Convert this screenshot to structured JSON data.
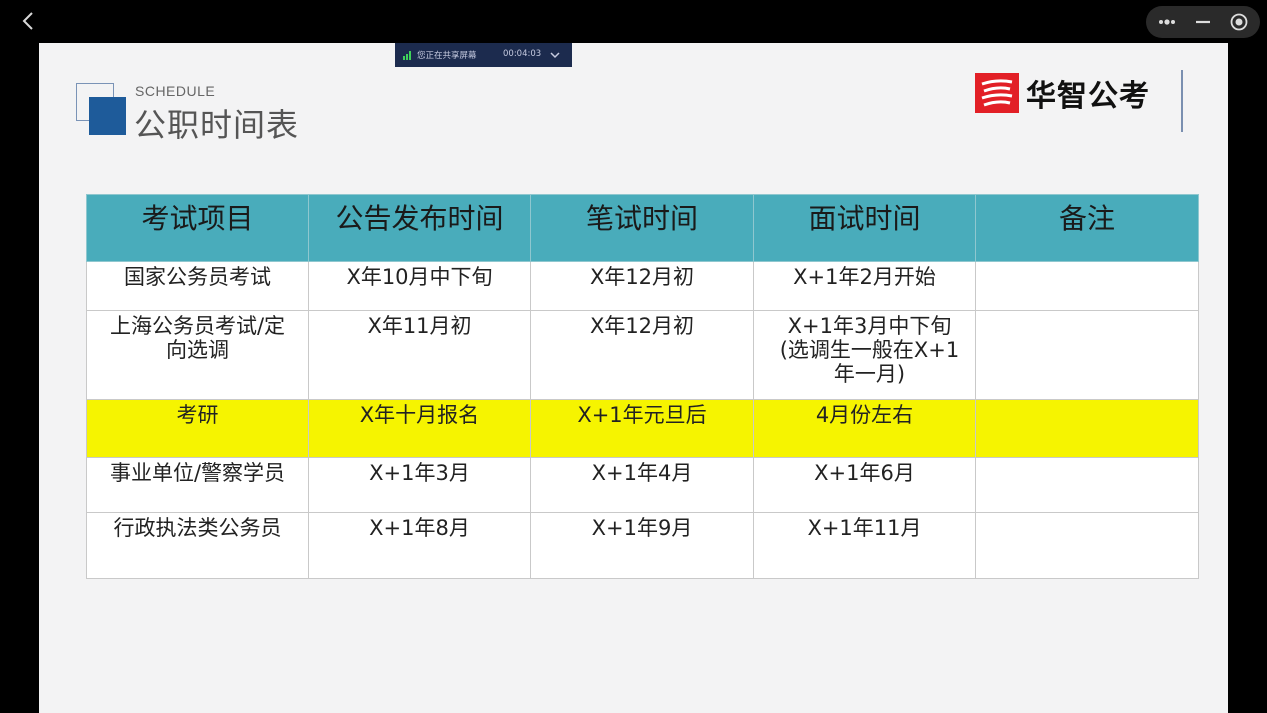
{
  "window": {
    "back_icon": "chevron-left-icon",
    "controls": [
      "more-icon",
      "minimize-icon",
      "record-icon"
    ]
  },
  "share_bar": {
    "status": "您正在共享屏幕",
    "timer": "00:04:03"
  },
  "slide": {
    "subtitle_en": "SCHEDULE",
    "title": "公职时间表",
    "logo_text": "华智公考",
    "table": {
      "headers": [
        "考试项目",
        "公告发布时间",
        "笔试时间",
        "面试时间",
        "备注"
      ],
      "rows": [
        {
          "item": "国家公务员考试",
          "announce": "X年10月中下旬",
          "written": "X年12月初",
          "interview": "X+1年2月开始",
          "note": ""
        },
        {
          "item": "上海公务员考试/定向选调",
          "announce": "X年11月初",
          "written": "X年12月初",
          "interview": "X+1年3月中下旬(选调生一般在X+1年一月)",
          "note": ""
        },
        {
          "item": "考研",
          "announce": "X年十月报名",
          "written": "X+1年元旦后",
          "interview": "4月份左右",
          "note": "",
          "highlight": true
        },
        {
          "item": "事业单位/警察学员",
          "announce": "X+1年3月",
          "written": "X+1年4月",
          "interview": "X+1年6月",
          "note": ""
        },
        {
          "item": "行政执法类公务员",
          "announce": "X+1年8月",
          "written": "X+1年9月",
          "interview": "X+1年11月",
          "note": ""
        }
      ]
    },
    "colors": {
      "header_bg": "#49acbb",
      "highlight_bg": "#f6f400",
      "title_accent": "#1e5b9a",
      "logo_red": "#e21f26"
    }
  }
}
